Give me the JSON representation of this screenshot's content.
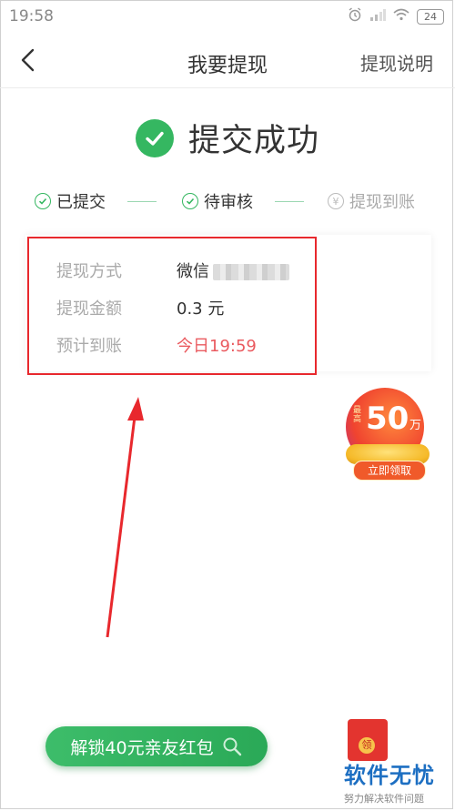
{
  "status_bar": {
    "time": "19:58",
    "battery": "24"
  },
  "nav": {
    "title": "我要提现",
    "help": "提现说明"
  },
  "success": {
    "text": "提交成功",
    "color": "#35b761"
  },
  "steps": [
    {
      "label": "已提交",
      "state": "done"
    },
    {
      "label": "待审核",
      "state": "done"
    },
    {
      "label": "提现到账",
      "state": "pending",
      "icon": "¥"
    }
  ],
  "details": [
    {
      "label": "提现方式",
      "value": "微信"
    },
    {
      "label": "提现金额",
      "value": "0.3 元"
    },
    {
      "label": "预计到账",
      "value": "今日19:59",
      "highlight": true
    }
  ],
  "promo": {
    "small": "最高",
    "amount": "50",
    "unit": "万",
    "button": "立即领取"
  },
  "unlock_button": {
    "label": "解锁40元亲友红包"
  },
  "red_packet": {
    "seal": "领"
  },
  "watermark": {
    "main": "软件无忧",
    "sub": "努力解决软件问题"
  },
  "colors": {
    "accent": "#35b761",
    "annotation": "#e8282d",
    "eta": "#ea5a5f"
  }
}
